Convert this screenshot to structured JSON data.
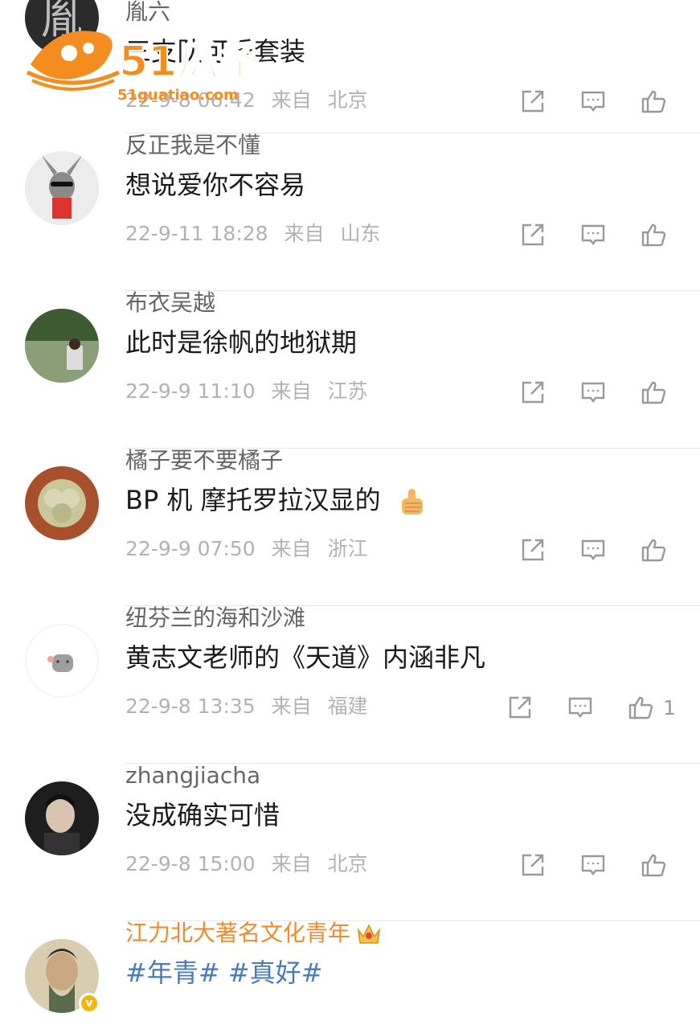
{
  "watermark": {
    "brand": "51瓜条",
    "url": "51guatiao.com"
  },
  "comments": [
    {
      "user": "胤六",
      "text": "三支队可乐套装",
      "date": "22-9-8 06:42",
      "from": "来自",
      "location": "北京",
      "likes": ""
    },
    {
      "user": "反正我是不懂",
      "text": "想说爱你不容易",
      "date": "22-9-11 18:28",
      "from": "来自",
      "location": "山东",
      "likes": ""
    },
    {
      "user": "布衣吴越",
      "text": "此时是徐帆的地狱期",
      "date": "22-9-9 11:10",
      "from": "来自",
      "location": "江苏",
      "likes": ""
    },
    {
      "user": "橘子要不要橘子",
      "text": "BP 机 摩托罗拉汉显的",
      "date": "22-9-9 07:50",
      "from": "来自",
      "location": "浙江",
      "likes": ""
    },
    {
      "user": "纽芬兰的海和沙滩",
      "text": "黄志文老师的《天道》内涵非凡",
      "date": "22-9-8 13:35",
      "from": "来自",
      "location": "福建",
      "likes": "1"
    },
    {
      "user": "zhangjiacha",
      "text": "没成确实可惜",
      "date": "22-9-8 15:00",
      "from": "来自",
      "location": "北京",
      "likes": ""
    },
    {
      "user": "江力北大著名文化青年",
      "text": "#年青# #真好#",
      "verified_badge": "v"
    }
  ],
  "icons": {
    "share": "share-icon",
    "reply": "comment-icon",
    "like": "thumbs-up-icon"
  },
  "colors": {
    "vip_name": "#f08a2c",
    "hashtag": "#4a7ab9",
    "meta": "#b2b2b2",
    "watermark": "#f58c1f"
  }
}
